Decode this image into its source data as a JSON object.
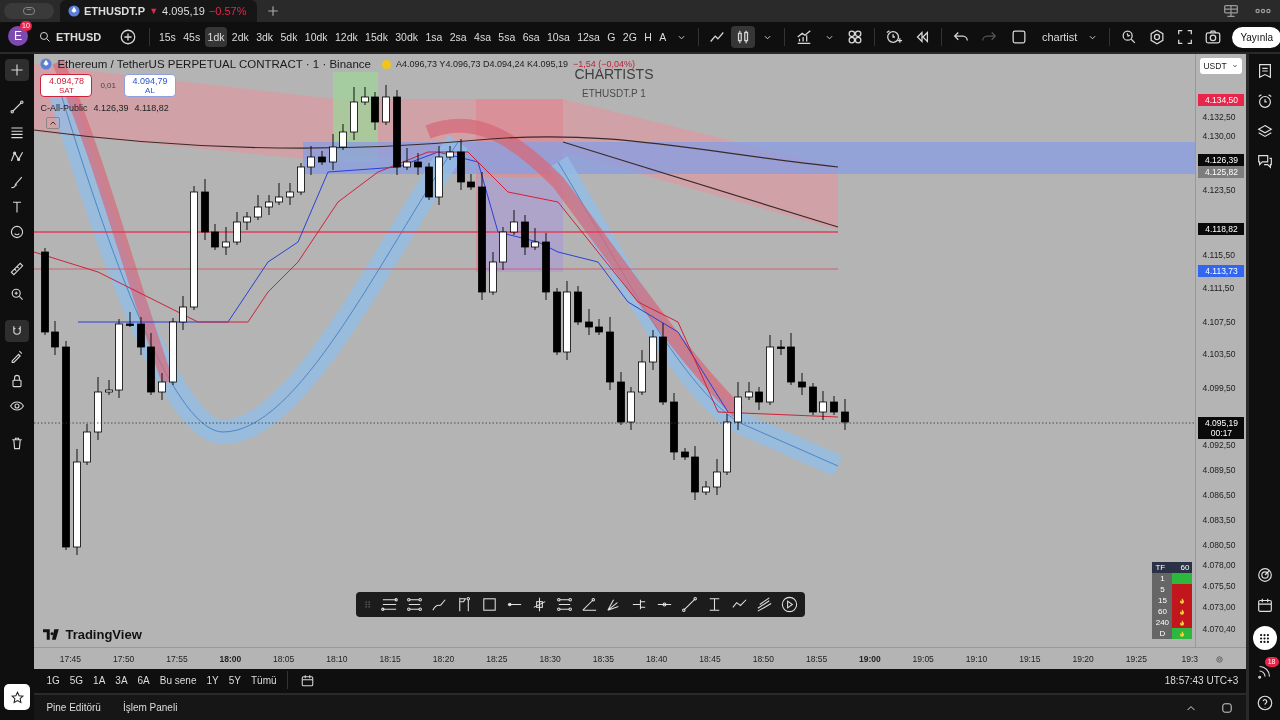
{
  "tab_bar": {
    "symbol": "ETHUSDT.P",
    "arrow": "▼",
    "price": "4.095,19",
    "change": "−0.57%"
  },
  "toolbar": {
    "avatar_letter": "E",
    "notifications": "10",
    "symbol": "ETHUSD",
    "intervals": [
      {
        "label": "15s",
        "selected": false
      },
      {
        "label": "45s",
        "selected": false
      },
      {
        "label": "1dk",
        "selected": true
      },
      {
        "label": "2dk",
        "selected": false
      },
      {
        "label": "3dk",
        "selected": false
      },
      {
        "label": "5dk",
        "selected": false
      },
      {
        "label": "10dk",
        "selected": false
      },
      {
        "label": "12dk",
        "selected": false
      },
      {
        "label": "15dk",
        "selected": false
      },
      {
        "label": "30dk",
        "selected": false
      },
      {
        "label": "1sa",
        "selected": false
      },
      {
        "label": "2sa",
        "selected": false
      },
      {
        "label": "4sa",
        "selected": false
      },
      {
        "label": "5sa",
        "selected": false
      },
      {
        "label": "6sa",
        "selected": false
      },
      {
        "label": "10sa",
        "selected": false
      },
      {
        "label": "12sa",
        "selected": false
      },
      {
        "label": "G",
        "selected": false
      },
      {
        "label": "2G",
        "selected": false
      },
      {
        "label": "H",
        "selected": false
      },
      {
        "label": "A",
        "selected": false
      }
    ],
    "chart_types": [
      {
        "kind": "line",
        "selected": false
      },
      {
        "kind": "candles",
        "selected": true
      }
    ],
    "redo_disabled": true,
    "layout_name": "chartist",
    "publish": "Yayınla"
  },
  "left_tools": [
    {
      "active": true
    },
    {
      "active": false
    },
    {
      "active": false
    },
    {
      "active": false
    },
    {
      "active": false
    },
    {
      "active": false
    },
    {
      "active": false
    },
    {
      "active": false
    },
    {
      "active": false
    },
    {
      "active": true
    },
    {
      "active": false
    },
    {
      "active": false
    },
    {
      "active": false
    },
    {
      "active": false
    }
  ],
  "legend": {
    "title": "Ethereum / TetherUS PERPETUAL CONTRACT · 1 · Binance",
    "ohlc": "A4.096,73 Y4.096,73 D4.094,24 K4.095,19",
    "change": "−1,54 (−0,04%)",
    "sell": {
      "price": "4.094,78",
      "label": "SAT"
    },
    "spread": "0,01",
    "buy": {
      "price": "4.094,79",
      "label": "AL"
    },
    "indicator": {
      "name": "C-All-Public",
      "values": [
        "4.126,39",
        "4.118,82"
      ]
    }
  },
  "watermark": {
    "title": "CHARTISTS",
    "subtitle": "ETHUSDT.P 1"
  },
  "currency": "USDT",
  "price_axis": [
    {
      "text": "4.134,50",
      "kind": "tag",
      "color": "#e8254a"
    },
    {
      "text": "4.132,50",
      "kind": "tick"
    },
    {
      "text": "4.130,00",
      "kind": "tick"
    },
    {
      "text": "4.126,39",
      "kind": "tag",
      "color": "#0a0a0a"
    },
    {
      "text": "4.125,82",
      "kind": "tag",
      "color": "#7d7d7d"
    },
    {
      "text": "4.123,50",
      "kind": "tick"
    },
    {
      "text": "4.118,82",
      "kind": "tag",
      "color": "#0a0a0a"
    },
    {
      "text": "4.115,50",
      "kind": "tick"
    },
    {
      "text": "4.113,73",
      "kind": "tag",
      "color": "#3366f0"
    },
    {
      "text": "4.111,50",
      "kind": "tick"
    },
    {
      "text": "4.107,50",
      "kind": "tick"
    },
    {
      "text": "4.103,50",
      "kind": "tick"
    },
    {
      "text": "4.099,50",
      "kind": "tick"
    },
    {
      "text": "4.095,19",
      "sub": "00:17",
      "kind": "tag",
      "color": "#0a0a0a"
    },
    {
      "text": "4.092,50",
      "kind": "tick"
    },
    {
      "text": "4.089,50",
      "kind": "tick"
    },
    {
      "text": "4.086,50",
      "kind": "tick"
    },
    {
      "text": "4.083,50",
      "kind": "tick"
    },
    {
      "text": "4.080,50",
      "kind": "tick"
    },
    {
      "text": "4.078,00",
      "kind": "tick"
    },
    {
      "text": "4.075,50",
      "kind": "tick"
    },
    {
      "text": "4.073,00",
      "kind": "tick"
    },
    {
      "text": "4.070,40",
      "kind": "tick"
    }
  ],
  "time_axis": [
    {
      "text": "17:45",
      "bold": false
    },
    {
      "text": "17:50",
      "bold": false
    },
    {
      "text": "17:55",
      "bold": false
    },
    {
      "text": "18:00",
      "bold": true
    },
    {
      "text": "18:05",
      "bold": false
    },
    {
      "text": "18:10",
      "bold": false
    },
    {
      "text": "18:15",
      "bold": false
    },
    {
      "text": "18:20",
      "bold": false
    },
    {
      "text": "18:25",
      "bold": false
    },
    {
      "text": "18:30",
      "bold": false
    },
    {
      "text": "18:35",
      "bold": false
    },
    {
      "text": "18:40",
      "bold": false
    },
    {
      "text": "18:45",
      "bold": false
    },
    {
      "text": "18:50",
      "bold": false
    },
    {
      "text": "18:55",
      "bold": false
    },
    {
      "text": "19:00",
      "bold": true
    },
    {
      "text": "19:05",
      "bold": false
    },
    {
      "text": "19:10",
      "bold": false
    },
    {
      "text": "19:15",
      "bold": false
    },
    {
      "text": "19:20",
      "bold": false
    },
    {
      "text": "19:25",
      "bold": false
    },
    {
      "text": "19:3",
      "bold": false
    }
  ],
  "tf_table": {
    "header": [
      "TF",
      "60"
    ],
    "rows": [
      {
        "tf": "1",
        "color": "#2db83d",
        "flame": false
      },
      {
        "tf": "5",
        "color": "#c0161c",
        "flame": false
      },
      {
        "tf": "15",
        "color": "#c0161c",
        "flame": true
      },
      {
        "tf": "60",
        "color": "#c0161c",
        "flame": true
      },
      {
        "tf": "240",
        "color": "#c0161c",
        "flame": true
      },
      {
        "tf": "D",
        "color": "#2db83d",
        "flame": true
      }
    ]
  },
  "logo": "TradingView",
  "ranges": [
    "1G",
    "5G",
    "1A",
    "3A",
    "6A",
    "Bu sene",
    "1Y",
    "5Y",
    "Tümü"
  ],
  "clock": "18:57:43 UTC+3",
  "panels": [
    "Pine Editörü",
    "İşlem Paneli"
  ],
  "sidebar_badge": "18"
}
